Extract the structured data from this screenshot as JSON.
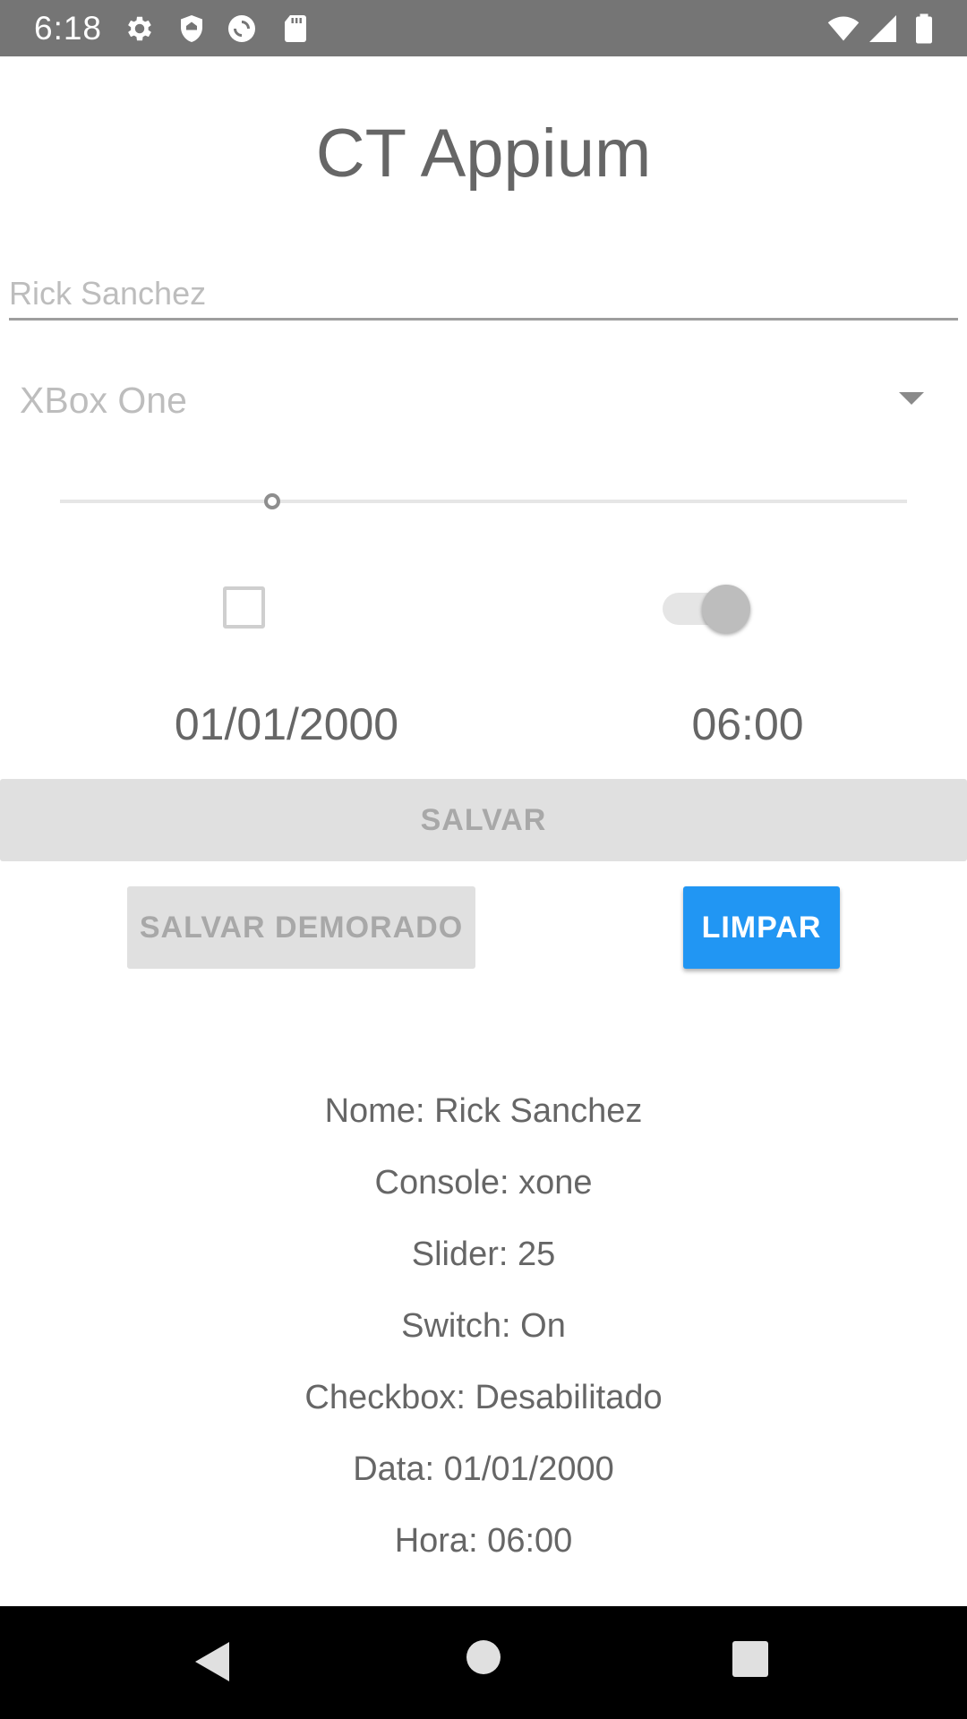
{
  "status_bar": {
    "time": "6:18",
    "left_icons": [
      "gear-icon",
      "shield-icon",
      "sync-icon",
      "sd-card-icon"
    ],
    "right_icons": [
      "wifi-icon",
      "signal-icon",
      "battery-icon"
    ]
  },
  "app": {
    "title": "CT Appium"
  },
  "form": {
    "name_placeholder": "Rick Sanchez",
    "name_value": "",
    "console_selected": "XBox One",
    "slider_value_fraction": 0.25,
    "checkbox_checked": false,
    "switch_on": true,
    "date": "01/01/2000",
    "time": "06:00"
  },
  "buttons": {
    "salvar": "SALVAR",
    "salvar_demorado": "SALVAR DEMORADO",
    "limpar": "LIMPAR"
  },
  "results": [
    "Nome: Rick Sanchez",
    "Console: xone",
    "Slider: 25",
    "Switch: On",
    "Checkbox: Desabilitado",
    "Data: 01/01/2000",
    "Hora: 06:00"
  ],
  "colors": {
    "status_bar": "#757575",
    "accent": "#2196f3",
    "disabled_button": "#e0e0e0",
    "nav_bar": "#000000"
  },
  "nav_bar": {
    "icons": [
      "back-icon",
      "home-icon",
      "recents-icon"
    ]
  }
}
